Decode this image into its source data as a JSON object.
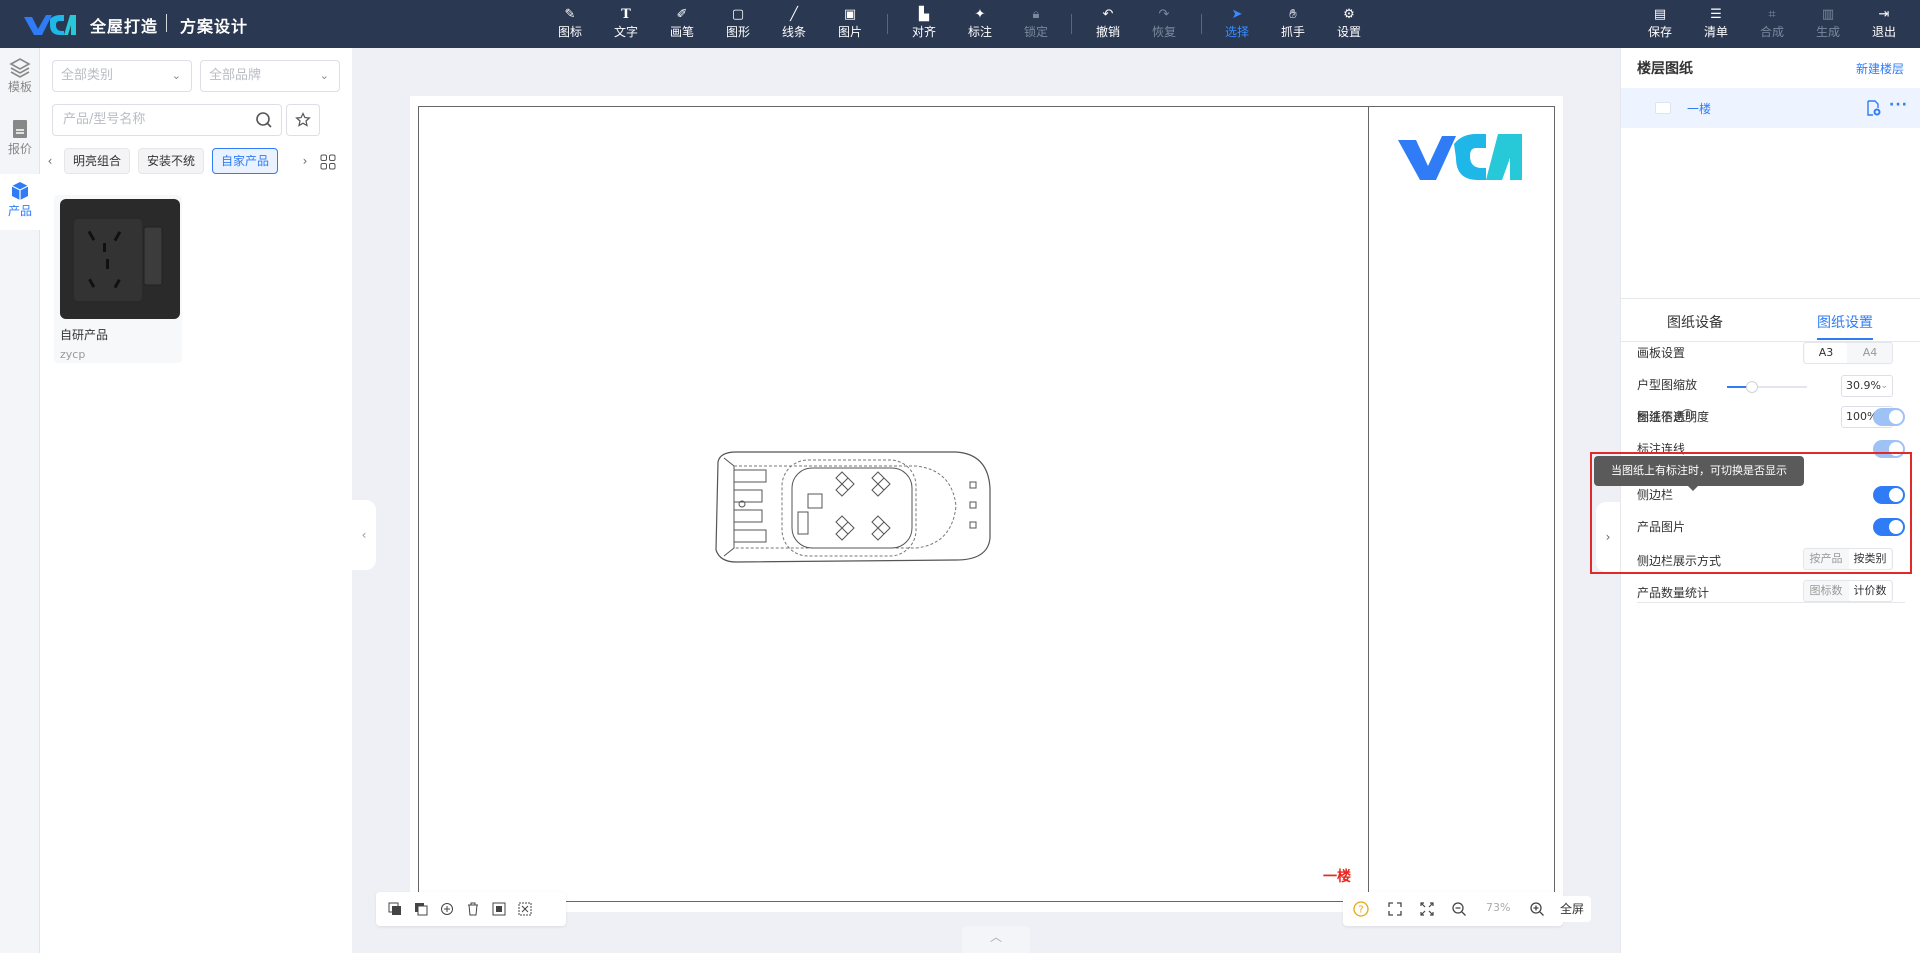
{
  "app": {
    "brand": "全屋打造",
    "subtitle": "方案设计",
    "accent_color": "#2f7cf6",
    "topbar_color": "#2b3852"
  },
  "toolbar": {
    "tools": [
      {
        "label": "图标",
        "icon": "icon-brush-icon"
      },
      {
        "label": "文字",
        "icon": "text-icon"
      },
      {
        "label": "画笔",
        "icon": "pen-icon"
      },
      {
        "label": "图形",
        "icon": "shape-icon"
      },
      {
        "label": "线条",
        "icon": "line-icon"
      },
      {
        "label": "图片",
        "icon": "image-icon"
      },
      {
        "label": "对齐",
        "icon": "align-icon"
      },
      {
        "label": "标注",
        "icon": "pin-icon"
      },
      {
        "label": "锁定",
        "icon": "lock-icon"
      },
      {
        "label": "撤销",
        "icon": "undo-icon"
      },
      {
        "label": "恢复",
        "icon": "redo-icon"
      },
      {
        "label": "选择",
        "icon": "cursor-icon"
      },
      {
        "label": "抓手",
        "icon": "hand-icon"
      },
      {
        "label": "设置",
        "icon": "gear-icon"
      }
    ],
    "actions": [
      {
        "label": "保存",
        "icon": "save-icon"
      },
      {
        "label": "清单",
        "icon": "list-icon"
      },
      {
        "label": "合成",
        "icon": "compose-icon"
      },
      {
        "label": "生成",
        "icon": "generate-icon"
      },
      {
        "label": "退出",
        "icon": "exit-icon"
      }
    ]
  },
  "rail": {
    "items": [
      {
        "label": "模板",
        "icon": "layers-icon"
      },
      {
        "label": "报价",
        "icon": "quote-icon"
      },
      {
        "label": "产品",
        "icon": "cube-icon"
      }
    ]
  },
  "products": {
    "category_placeholder": "全部类别",
    "brand_placeholder": "全部品牌",
    "search_placeholder": "产品/型号名称",
    "chips": [
      "明亮组合",
      "安装不统",
      "自家产品"
    ],
    "selected_chip": "自家产品",
    "cards": [
      {
        "name": "自研产品",
        "code": "zycp"
      }
    ]
  },
  "canvas": {
    "floor_label": "一楼",
    "zoom": "73%",
    "fullscreen_label": "全屏"
  },
  "right_panel": {
    "title": "楼层图纸",
    "new_floor": "新建楼层",
    "floor_name": "一楼",
    "tabs": [
      "图纸设备",
      "图纸设置"
    ],
    "active_tab": "图纸设置",
    "settings": {
      "board_label": "画板设置",
      "board_options": [
        "A3",
        "A4"
      ],
      "board_selected": "A3",
      "zoom_label": "户型图缩放",
      "zoom_value": "30.9%",
      "zoom_fraction": 0.309,
      "opacity_label": "图纸不透明度",
      "opacity_value": "100%",
      "annotation_info_label": "标注信息",
      "annotation_line_label": "标注连线",
      "sidebar_label": "侧边栏",
      "product_image_label": "产品图片",
      "sidebar_display_label": "侧边栏展示方式",
      "sidebar_display_options": [
        "按产品",
        "按类别"
      ],
      "sidebar_display_selected": "按类别",
      "count_label": "产品数量统计",
      "count_options": [
        "图标数",
        "计价数"
      ],
      "count_selected": "计价数"
    },
    "tooltip": "当图纸上有标注时，可切换是否显示"
  }
}
